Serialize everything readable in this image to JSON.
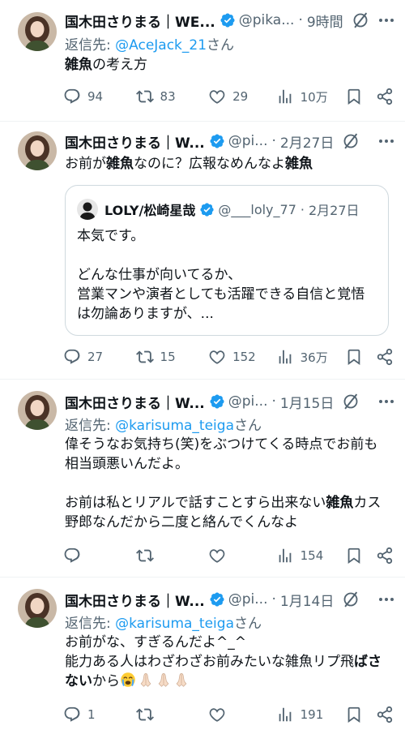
{
  "tweets": [
    {
      "author": "国木田さりまる｜WE...",
      "handle": "@pika...",
      "time": "9時間",
      "reply_to_prefix": "返信先: ",
      "reply_to_account": "@AceJack_21",
      "reply_to_suffix": "さん",
      "text_bold": "雑魚",
      "text_rest": "の考え方",
      "stats": {
        "replies": "94",
        "reposts": "83",
        "likes": "29",
        "views": "10万"
      }
    },
    {
      "author": "国木田さりまる｜W...",
      "handle": "@pi...",
      "time": "2月27日",
      "text_a": "お前が",
      "text_b": "雑魚",
      "text_c": "なのに？広報なめんなよ",
      "text_d": "雑魚",
      "quote": {
        "author": "LOLY/松崎星哉",
        "handle": "@___loly_77",
        "time": "2月27日",
        "text": "本気です。\n\nどんな仕事が向いてるか、\n営業マンや演者としても活躍できる自信と覚悟\nは勿論ありますが、..."
      },
      "stats": {
        "replies": "27",
        "reposts": "15",
        "likes": "152",
        "views": "36万"
      }
    },
    {
      "author": "国木田さりまる｜W...",
      "handle": "@pi...",
      "time": "1月15日",
      "reply_to_prefix": "返信先: ",
      "reply_to_account": "@karisuma_teiga",
      "reply_to_suffix": "さん",
      "text_a": "偉そうなお気持ち(笑)をぶつけてくる時点でお前も\n相当頭悪いんだよ。\n\nお前は私とリアルで話すことすら出来ない",
      "text_b": "雑魚",
      "text_c": "カス\n野郎なんだから二度と絡んでくんなよ",
      "stats": {
        "replies": "",
        "reposts": "",
        "likes": "",
        "views": "154"
      }
    },
    {
      "author": "国木田さりまる｜W...",
      "handle": "@pi...",
      "time": "1月14日",
      "reply_to_prefix": "返信先: ",
      "reply_to_account": "@karisuma_teiga",
      "reply_to_suffix": "さん",
      "text_a": "お前がな、すぎるんだよ^_^\n能力ある人はわざわざお前みたいな雑魚リプ飛",
      "text_b": "ばさ\nない",
      "text_c": "から",
      "emojis": [
        "loudly-crying-face",
        "folded-hands",
        "folded-hands",
        "folded-hands"
      ],
      "stats": {
        "replies": "1",
        "reposts": "",
        "likes": "",
        "views": "191"
      }
    }
  ],
  "colors": {
    "text": "#0f1419",
    "secondary": "#536471",
    "link": "#1d9bf0",
    "verified": "#1d9bf0",
    "border": "#eff3f4"
  }
}
